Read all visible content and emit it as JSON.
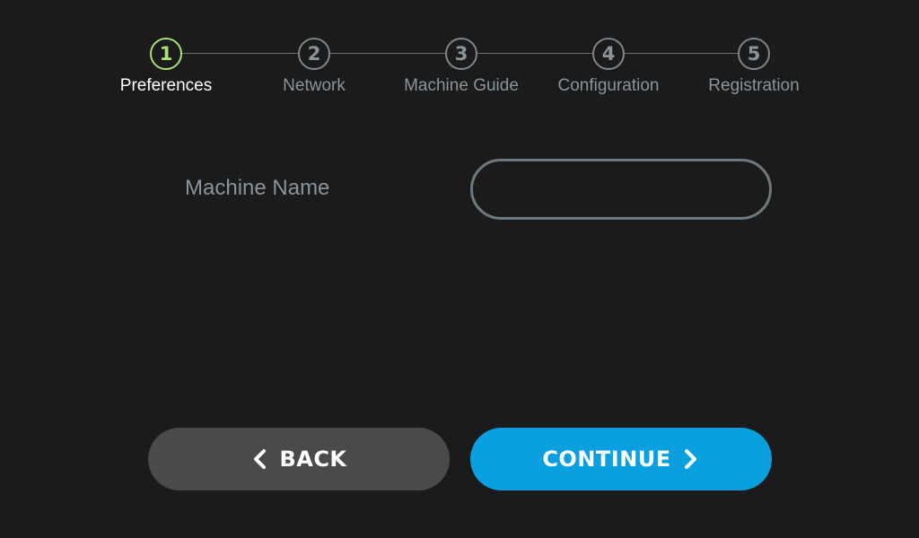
{
  "stepper": {
    "steps": [
      {
        "number": "1",
        "label": "Preferences",
        "active": true
      },
      {
        "number": "2",
        "label": "Network",
        "active": false
      },
      {
        "number": "3",
        "label": "Machine Guide",
        "active": false
      },
      {
        "number": "4",
        "label": "Configuration",
        "active": false
      },
      {
        "number": "5",
        "label": "Registration",
        "active": false
      }
    ],
    "active_color": "#a8e07a",
    "inactive_color": "#8a949b"
  },
  "form": {
    "machine_name_label": "Machine Name",
    "machine_name_value": "",
    "machine_name_placeholder": ""
  },
  "buttons": {
    "back_label": "BACK",
    "continue_label": "CONTINUE",
    "back_color": "#4a4a4a",
    "continue_color": "#0aa0e0"
  },
  "icons": {
    "back": "chevron-left-icon",
    "continue": "chevron-right-icon"
  }
}
